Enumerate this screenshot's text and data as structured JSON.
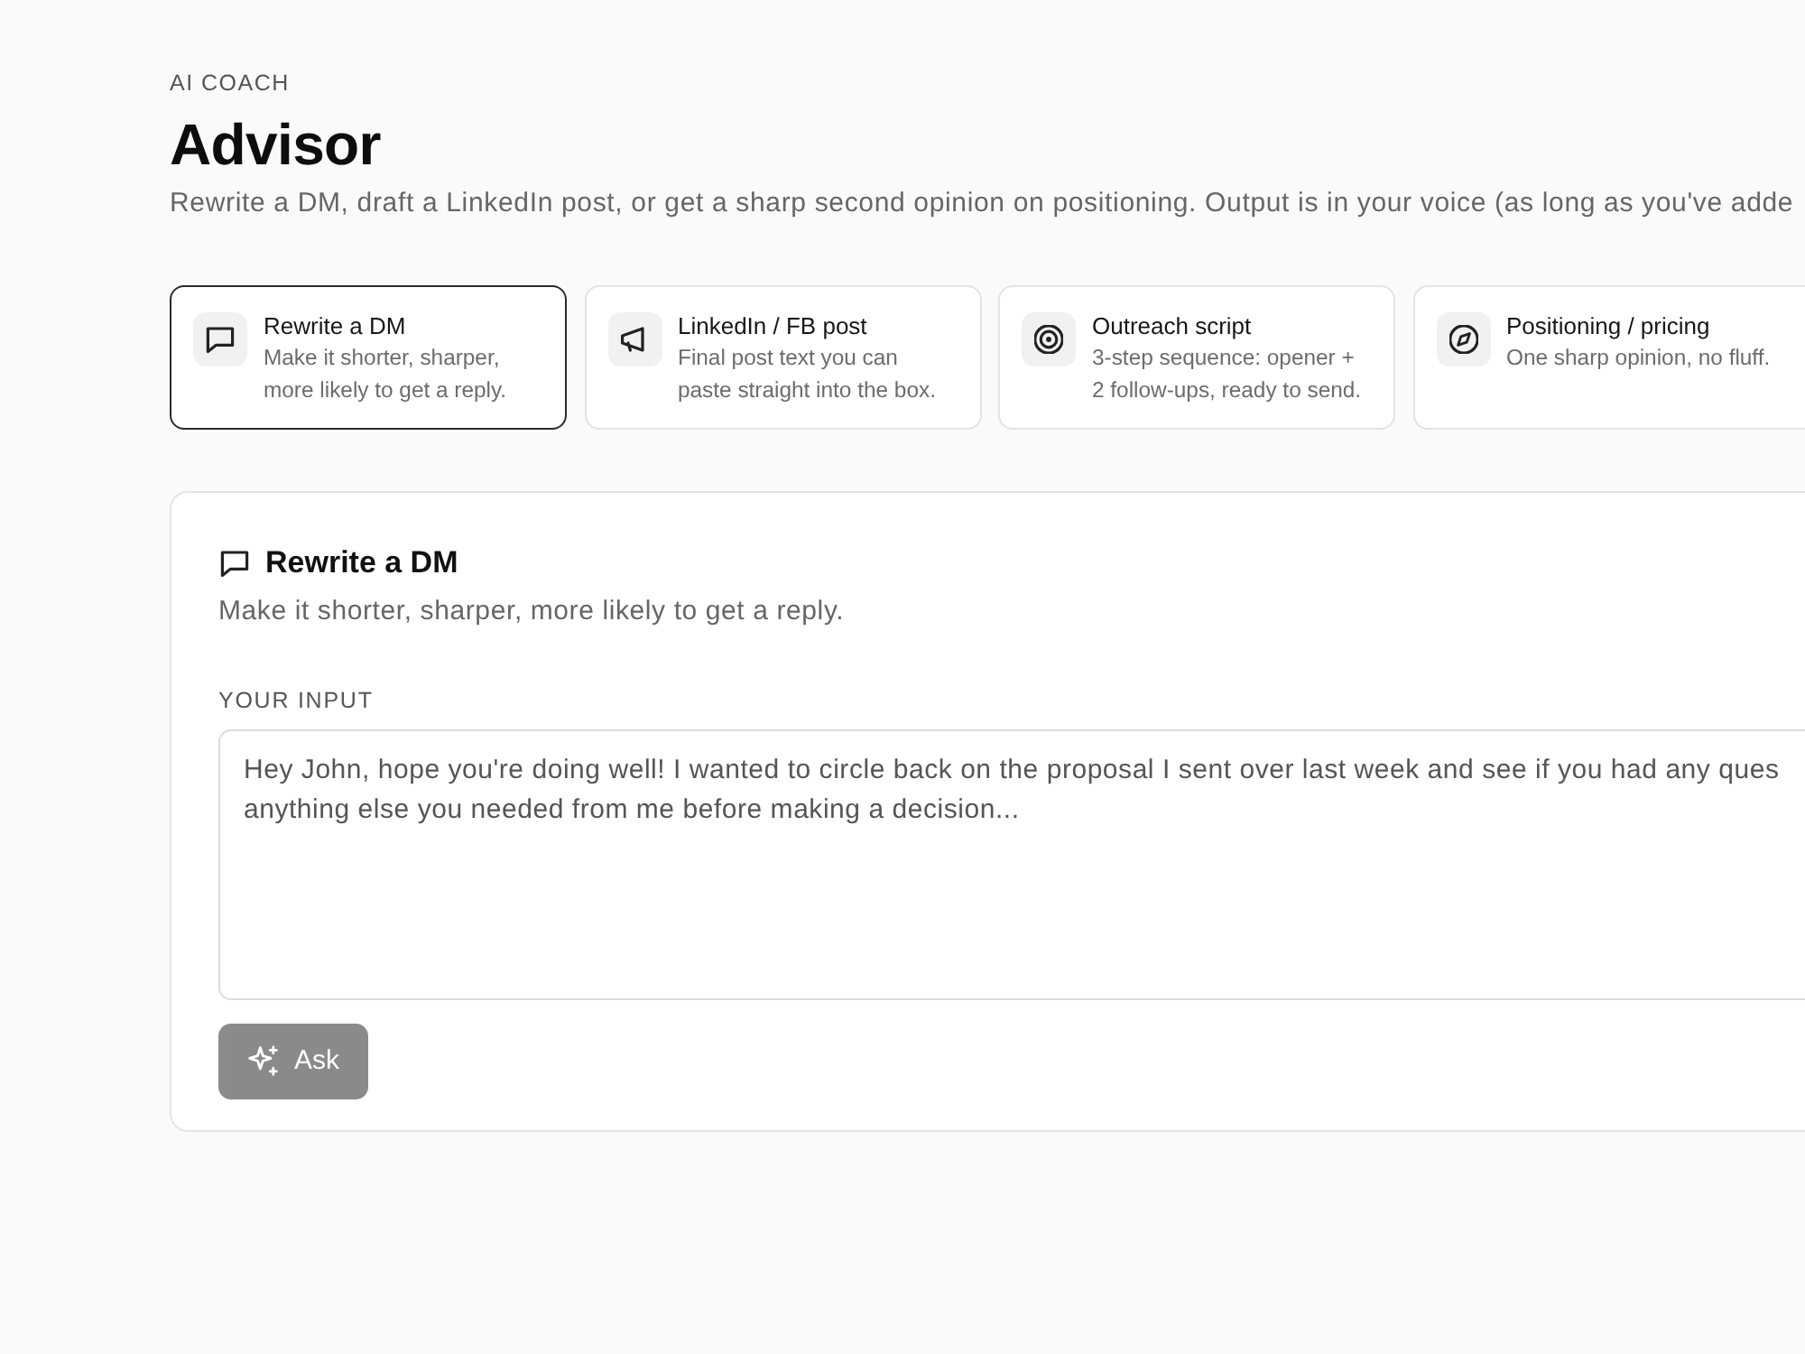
{
  "header": {
    "eyebrow": "AI COACH",
    "title": "Advisor",
    "subtitle": "Rewrite a DM, draft a LinkedIn post, or get a sharp second opinion on positioning. Output is in your voice (as long as you've adde"
  },
  "modes": [
    {
      "title": "Rewrite a DM",
      "description": "Make it shorter, sharper, more likely to get a reply.",
      "selected": true
    },
    {
      "title": "LinkedIn / FB post",
      "description": "Final post text you can paste straight into the box.",
      "selected": false
    },
    {
      "title": "Outreach script",
      "description": "3-step sequence: opener + 2 follow-ups, ready to send.",
      "selected": false
    },
    {
      "title": "Positioning / pricing",
      "description": "One sharp opinion, no fluff.",
      "selected": false
    }
  ],
  "panel": {
    "title": "Rewrite a DM",
    "description": "Make it shorter, sharper, more likely to get a reply.",
    "input_label": "YOUR INPUT",
    "input": {
      "value": "Hey John, hope you're doing well! I wanted to circle back on the proposal I sent over last week and see if you had any ques\nanything else you needed from me before making a decision..."
    },
    "ask_button": {
      "label": "Ask",
      "disabled": true
    }
  }
}
